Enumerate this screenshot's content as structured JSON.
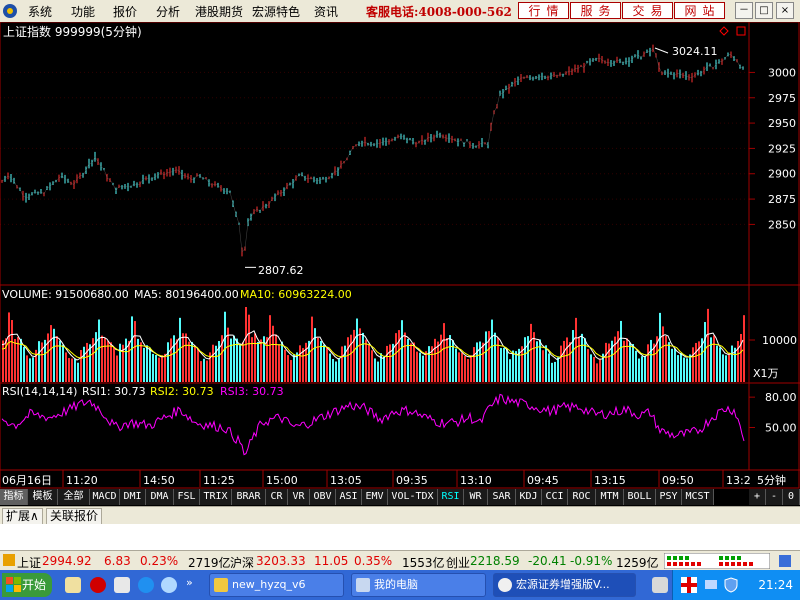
{
  "app": {
    "menu": [
      "系统",
      "功能",
      "报价",
      "分析",
      "港股期货",
      "宏源特色",
      "资讯"
    ],
    "phone": "客服电话:4008-000-562",
    "red_buttons": [
      "行情",
      "服务",
      "交易",
      "网站"
    ],
    "win_buttons": [
      "－",
      "□",
      "×"
    ]
  },
  "chart_data": {
    "type": "line",
    "title": "上证指数 999999(5分钟)",
    "price": {
      "y_ticks": [
        3000,
        2975,
        2950,
        2925,
        2900,
        2875,
        2850
      ],
      "ylim": [
        2805,
        3032
      ],
      "high_label": "3024.11",
      "low_label": "2807.62",
      "keypoints": [
        [
          0,
          2890
        ],
        [
          8,
          2900
        ],
        [
          25,
          2878
        ],
        [
          45,
          2882
        ],
        [
          60,
          2897
        ],
        [
          75,
          2890
        ],
        [
          95,
          2917
        ],
        [
          115,
          2885
        ],
        [
          135,
          2890
        ],
        [
          155,
          2898
        ],
        [
          175,
          2903
        ],
        [
          190,
          2895
        ],
        [
          200,
          2897
        ],
        [
          215,
          2888
        ],
        [
          230,
          2883
        ],
        [
          235,
          2860
        ],
        [
          240,
          2850
        ],
        [
          243,
          2812
        ],
        [
          248,
          2853
        ],
        [
          253,
          2860
        ],
        [
          270,
          2872
        ],
        [
          285,
          2885
        ],
        [
          300,
          2898
        ],
        [
          320,
          2893
        ],
        [
          340,
          2905
        ],
        [
          350,
          2920
        ],
        [
          360,
          2932
        ],
        [
          380,
          2930
        ],
        [
          400,
          2936
        ],
        [
          420,
          2930
        ],
        [
          440,
          2940
        ],
        [
          460,
          2932
        ],
        [
          480,
          2928
        ],
        [
          488,
          2930
        ],
        [
          493,
          2955
        ],
        [
          500,
          2978
        ],
        [
          520,
          2993
        ],
        [
          540,
          2997
        ],
        [
          560,
          2996
        ],
        [
          580,
          3005
        ],
        [
          600,
          3013
        ],
        [
          620,
          3010
        ],
        [
          640,
          3016
        ],
        [
          650,
          3020
        ],
        [
          655,
          3024
        ],
        [
          660,
          2998
        ],
        [
          670,
          2999
        ],
        [
          690,
          2996
        ],
        [
          700,
          3000
        ],
        [
          710,
          3005
        ],
        [
          720,
          3010
        ],
        [
          730,
          3018
        ],
        [
          738,
          3012
        ],
        [
          745,
          2998
        ]
      ]
    },
    "volume": {
      "label": "VOLUME: 91500680.00",
      "ma5_label": "MA5: 80196400.00",
      "ma10_label": "MA10: 60963224.00",
      "y_tick": "10000",
      "unit": "X1万",
      "peaks": [
        10,
        50,
        98,
        133,
        180,
        226,
        248,
        270,
        313,
        356,
        400,
        443,
        489,
        530,
        575,
        618,
        660,
        705,
        745
      ]
    },
    "rsi": {
      "label": "RSI(14,14,14)",
      "rsi1_label": "RSI1: 30.73",
      "rsi2_label": "RSI2: 30.73",
      "rsi3_label": "RSI3: 30.73",
      "y_ticks": [
        80.0,
        50.0
      ],
      "ylim": [
        10,
        92
      ],
      "keypoints": [
        [
          0,
          60
        ],
        [
          15,
          52
        ],
        [
          30,
          63
        ],
        [
          50,
          60
        ],
        [
          70,
          68
        ],
        [
          80,
          73
        ],
        [
          90,
          76
        ],
        [
          100,
          68
        ],
        [
          115,
          50
        ],
        [
          130,
          55
        ],
        [
          150,
          52
        ],
        [
          165,
          60
        ],
        [
          180,
          68
        ],
        [
          195,
          55
        ],
        [
          210,
          52
        ],
        [
          225,
          50
        ],
        [
          240,
          35
        ],
        [
          245,
          22
        ],
        [
          252,
          38
        ],
        [
          262,
          55
        ],
        [
          280,
          60
        ],
        [
          295,
          50
        ],
        [
          310,
          55
        ],
        [
          330,
          64
        ],
        [
          350,
          72
        ],
        [
          365,
          69
        ],
        [
          380,
          58
        ],
        [
          395,
          66
        ],
        [
          410,
          67
        ],
        [
          425,
          60
        ],
        [
          440,
          55
        ],
        [
          455,
          55
        ],
        [
          470,
          60
        ],
        [
          480,
          54
        ],
        [
          490,
          70
        ],
        [
          500,
          79
        ],
        [
          510,
          76
        ],
        [
          530,
          72
        ],
        [
          550,
          66
        ],
        [
          565,
          70
        ],
        [
          580,
          70
        ],
        [
          595,
          63
        ],
        [
          610,
          64
        ],
        [
          625,
          68
        ],
        [
          640,
          62
        ],
        [
          650,
          65
        ],
        [
          660,
          47
        ],
        [
          675,
          42
        ],
        [
          690,
          44
        ],
        [
          700,
          48
        ],
        [
          712,
          60
        ],
        [
          725,
          69
        ],
        [
          735,
          67
        ],
        [
          745,
          35
        ]
      ]
    },
    "x_labels": [
      "06月16日",
      "11:20",
      "14:50",
      "11:25",
      "15:00",
      "13:05",
      "09:35",
      "13:10",
      "09:45",
      "13:15",
      "09:50",
      "13:2"
    ],
    "period": "5分钟",
    "colors": {
      "up": "#ff3232",
      "down": "#54fcfc",
      "ma5": "#ffffff",
      "ma10": "#ffff00",
      "rsi": "#ff00ff",
      "grid": "#800000",
      "axis": "#a00000"
    }
  },
  "indicator_tabs": [
    "指标",
    "模板",
    "全部",
    "MACD",
    "DMI",
    "DMA",
    "FSL",
    "TRIX",
    "BRAR",
    "CR",
    "VR",
    "OBV",
    "ASI",
    "EMV",
    "VOL-TDX",
    "RSI",
    "WR",
    "SAR",
    "KDJ",
    "CCI",
    "ROC",
    "MTM",
    "BOLL",
    "PSY",
    "MCST"
  ],
  "tab_right": [
    "+",
    "-",
    "0"
  ],
  "sub_tabs": [
    "扩展∧",
    "关联报价"
  ],
  "status": {
    "sh_label": "上证",
    "sh_val": "2994.92",
    "sh_chg": "6.83",
    "sh_pct": "0.23%",
    "sh_amt": "2719亿",
    "hs_label": "沪深",
    "hs_val": "3203.33",
    "hs_chg": "11.05",
    "hs_pct": "0.35%",
    "hs_amt": "1553亿",
    "cy_label": "创业",
    "cy_val": "2218.59",
    "cy_chg": "-20.41",
    "cy_pct": "-0.91%",
    "cy_amt": "1259亿"
  },
  "taskbar": {
    "start": "开始",
    "windows": [
      "new_hyzq_v6",
      "我的电脑",
      "宏源证券增强版V..."
    ],
    "time": "21:24"
  }
}
